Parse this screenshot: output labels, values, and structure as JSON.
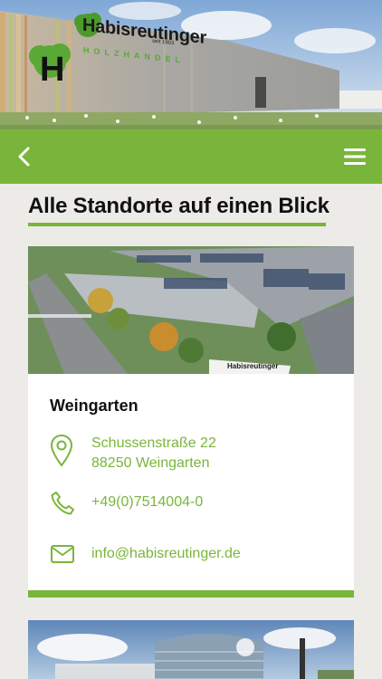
{
  "header": {
    "logo_text": "Habisreutinger",
    "logo_tagline": "HOLZHANDEL",
    "logo_since": "seit 1903",
    "logo_letter": "H"
  },
  "navbar": {
    "back_icon": "chevron-left-icon",
    "menu_icon": "hamburger-menu-icon",
    "color": "#7ab53b"
  },
  "page": {
    "title": "Alle Standorte auf einen Blick"
  },
  "locations": [
    {
      "name": "Weingarten",
      "street": "Schussenstraße 22",
      "city": "88250 Weingarten",
      "phone": "+49(0)7514004-0",
      "email": "info@habisreutinger.de",
      "photo_sign": "Habisreutinger"
    }
  ],
  "colors": {
    "accent": "#7ab53b",
    "background": "#ecebe7"
  }
}
